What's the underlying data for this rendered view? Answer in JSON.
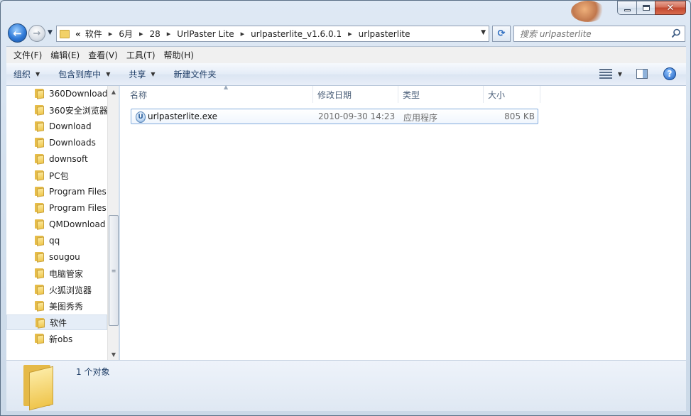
{
  "window": {
    "caption_buttons": {
      "minimize_icon": "minimize-icon",
      "maximize_icon": "maximize-icon",
      "close_icon": "close-icon"
    }
  },
  "nav": {
    "back_icon": "back-arrow-icon",
    "forward_icon": "forward-arrow-icon",
    "breadcrumb_prefix": "«",
    "breadcrumb": [
      "软件",
      "6月",
      "28",
      "UrlPaster Lite",
      "urlpasterlite_v1.6.0.1",
      "urlpasterlite"
    ],
    "search_placeholder": "搜索 urlpasterlite"
  },
  "menubar": [
    {
      "label": "文件(F)"
    },
    {
      "label": "编辑(E)"
    },
    {
      "label": "查看(V)"
    },
    {
      "label": "工具(T)"
    },
    {
      "label": "帮助(H)"
    }
  ],
  "commandbar": {
    "organize": "组织",
    "include_in_library": "包含到库中",
    "share": "共享",
    "new_folder": "新建文件夹"
  },
  "tree": [
    {
      "label": "360Download"
    },
    {
      "label": "360安全浏览器"
    },
    {
      "label": "Download"
    },
    {
      "label": "Downloads"
    },
    {
      "label": "downsoft"
    },
    {
      "label": "PC包"
    },
    {
      "label": "Program Files"
    },
    {
      "label": "Program Files"
    },
    {
      "label": "QMDownload"
    },
    {
      "label": "qq"
    },
    {
      "label": "sougou"
    },
    {
      "label": "电脑管家"
    },
    {
      "label": "火狐浏览器"
    },
    {
      "label": "美图秀秀"
    },
    {
      "label": "软件",
      "selected": true
    },
    {
      "label": "新obs"
    }
  ],
  "columns": {
    "name": "名称",
    "modified": "修改日期",
    "type": "类型",
    "size": "大小"
  },
  "files": [
    {
      "name": "urlpasterlite.exe",
      "modified": "2010-09-30 14:23",
      "type": "应用程序",
      "size": "805 KB",
      "icon": "exe-icon"
    }
  ],
  "details": {
    "count_text": "1 个对象",
    "icon": "folder-icon"
  }
}
